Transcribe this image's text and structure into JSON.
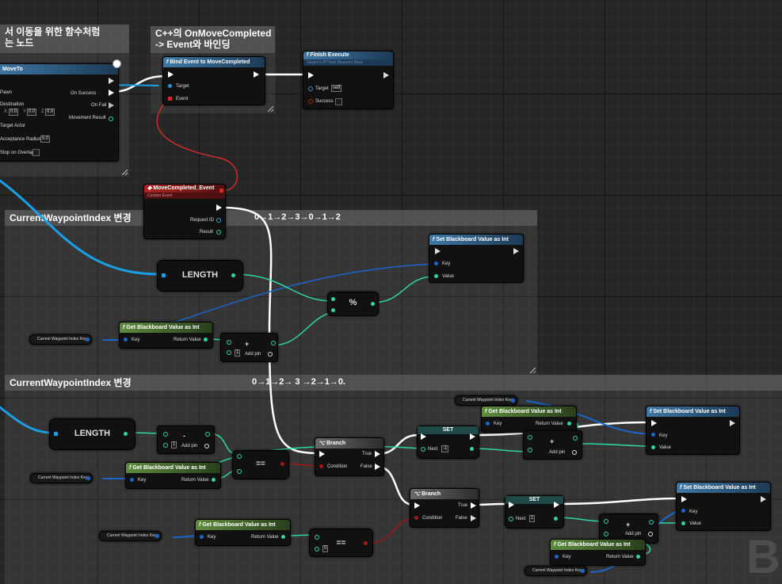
{
  "comments": {
    "top_left": "서 이동을 위한 함수처럼\n는 노드",
    "top_mid": "C++의 OnMoveCompleted\n-> Event와 바인딩",
    "middle": "CurrentWaypointIndex 변경",
    "bottom": "CurrentWaypointIndex 변경"
  },
  "annotations": {
    "sequence_a": "0→1→2→3→0→1→2",
    "sequence_b": "0→1→2→ 3 →2→1→0."
  },
  "nodes": {
    "move_to": {
      "title": "MoveTo",
      "pawn": "Pawn",
      "destination": "Destination",
      "x_label": "X",
      "x_value": "0.0",
      "y_label": "Y",
      "y_value": "0.0",
      "z_label": "Z",
      "z_value": "0.0",
      "target_actor": "Target Actor",
      "acceptance_radius": "Acceptance Radius",
      "acceptance_value": "5.0",
      "stop_on_overlap": "Stop on Overlap",
      "on_success": "On Success",
      "on_fail": "On Fail",
      "movement_result": "Movement Result"
    },
    "bind_event": {
      "title": "Bind Event to MoveCompleted",
      "target": "Target",
      "event": "Event"
    },
    "finish_execute": {
      "title": "Finish Execute",
      "subtitle": "Target is BTTask Blueprint Base",
      "target": "Target",
      "target_value": "self",
      "success": "Success"
    },
    "custom_event": {
      "title": "MoveCompleted_Event",
      "subtitle": "Custom Event",
      "request_id": "Request ID",
      "result": "Result"
    },
    "length_a": "LENGTH",
    "length_b": "LENGTH",
    "set_bb_a": {
      "title": "Set Blackboard Value as Int",
      "key": "Key",
      "value": "Value"
    },
    "get_bb_a": {
      "title": "Get Blackboard Value as Int",
      "key": "Key",
      "return_value": "Return Value"
    },
    "mod_op": "%",
    "add_a": {
      "value": "1",
      "add_pin": "Add pin"
    },
    "key_var_a": "Current Waypoint Index Key",
    "key_var_b": "Current Waypoint Index Key",
    "key_var_c": "Current Waypoint Index Key",
    "key_var_d": "Current Waypoint Index Key",
    "key_var_e": "Current Waypoint Index Key",
    "sub_b": {
      "value": "1",
      "add_pin": "Add pin",
      "op": "-"
    },
    "get_bb_b": {
      "title": "Get Blackboard Value as Int",
      "key": "Key",
      "return_value": "Return Value"
    },
    "eq_a": "==",
    "branch_a": {
      "title": "Branch",
      "condition": "Condition",
      "true": "True",
      "false": "False"
    },
    "get_bb_c": {
      "title": "Get Blackboard Value as Int",
      "key": "Key",
      "return_value": "Return Value"
    },
    "set_var_a": {
      "title": "SET",
      "next": "Next",
      "value": "-1"
    },
    "add_c": {
      "add_pin": "Add pin",
      "op": "+"
    },
    "set_bb_b": {
      "title": "Set Blackboard Value as Int",
      "key": "Key",
      "value": "Value"
    },
    "branch_b": {
      "title": "Branch",
      "condition": "Condition",
      "true": "True",
      "false": "False"
    },
    "get_bb_d": {
      "title": "Get Blackboard Value as Int",
      "key": "Key",
      "return_value": "Return Value"
    },
    "eq_b": {
      "op": "==",
      "value": "0"
    },
    "set_var_b": {
      "title": "SET",
      "next": "Next",
      "value": "1"
    },
    "add_d": {
      "add_pin": "Add pin",
      "op": "+"
    },
    "get_bb_e": {
      "title": "Get Blackboard Value as Int",
      "key": "Key",
      "return_value": "Return Value"
    },
    "set_bb_c": {
      "title": "Set Blackboard Value as Int",
      "key": "Key",
      "value": "Value"
    }
  },
  "watermark": "B",
  "colors": {
    "exec": "#ffffff",
    "int": "#2fd5a5",
    "key": "#1a66cc",
    "array": "#1aa0e6",
    "event": "#d22a2a",
    "bool": "#9b1a1a"
  }
}
